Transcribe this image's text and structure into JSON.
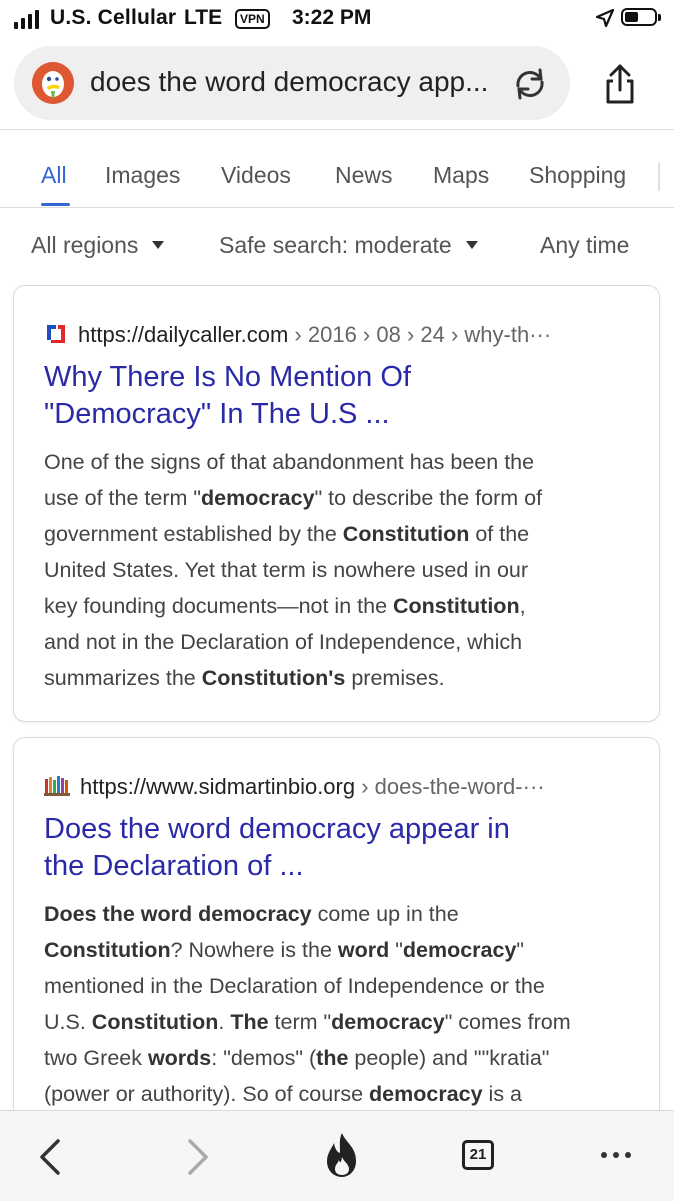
{
  "status_bar": {
    "carrier": "U.S. Cellular",
    "network": "LTE",
    "vpn": "VPN",
    "time": "3:22 PM"
  },
  "address_bar": {
    "query": "does the word democracy app..."
  },
  "tabs": [
    {
      "label": "All",
      "active": true
    },
    {
      "label": "Images"
    },
    {
      "label": "Videos"
    },
    {
      "label": "News"
    },
    {
      "label": "Maps"
    },
    {
      "label": "Shopping"
    }
  ],
  "filters": {
    "region": "All regions",
    "safe_search": "Safe search: moderate",
    "time": "Any time"
  },
  "results": [
    {
      "host": "https://dailycaller.com",
      "path": " › 2016 › 08 › 24 › why-th···",
      "title_line1": "Why There Is No Mention Of",
      "title_line2": "\"Democracy\" In The U.S ..."
    },
    {
      "host": "https://www.sidmartinbio.org",
      "path": " › does-the-word-···",
      "title_line1": "Does the word democracy appear in",
      "title_line2": "the Declaration of ..."
    }
  ],
  "snippet1": {
    "l1": "One of the signs of that abandonment has been the",
    "l2a": "use of the term \"",
    "l2b": "democracy",
    "l2c": "\" to describe the form of",
    "l3a": "government established by the ",
    "l3b": "Constitution",
    "l3c": " of the",
    "l4": "United States. Yet that term is nowhere used in our",
    "l5a": "key founding documents—not in the ",
    "l5b": "Constitution",
    "l5c": ",",
    "l6": "and not in the Declaration of Independence, which",
    "l7a": "summarizes the ",
    "l7b": "Constitution's",
    "l7c": " premises."
  },
  "snippet2": {
    "l1a": "Does the word democracy",
    "l1b": " come up in the",
    "l2a": "Constitution",
    "l2b": "? Nowhere is the ",
    "l2c": "word",
    "l2d": " \"",
    "l2e": "democracy",
    "l2f": "\"",
    "l3": "mentioned in the Declaration of Independence or the",
    "l4a": "U.S. ",
    "l4b": "Constitution",
    "l4c": ". ",
    "l4d": "The",
    "l4e": " term \"",
    "l4f": "democracy",
    "l4g": "\" comes from",
    "l5a": "two Greek ",
    "l5b": "words",
    "l5c": ": \"demos\" (",
    "l5d": "the",
    "l5e": " people) and \"\"kratia\"",
    "l6a": "(power or authority). So of course ",
    "l6b": "democracy",
    "l6c": " is a"
  },
  "toolbar": {
    "tab_count": "21"
  },
  "colors": {
    "accent": "#3367d6",
    "link": "#2a2aa8",
    "ddg_orange": "#de5833",
    "fire": "#222222"
  }
}
